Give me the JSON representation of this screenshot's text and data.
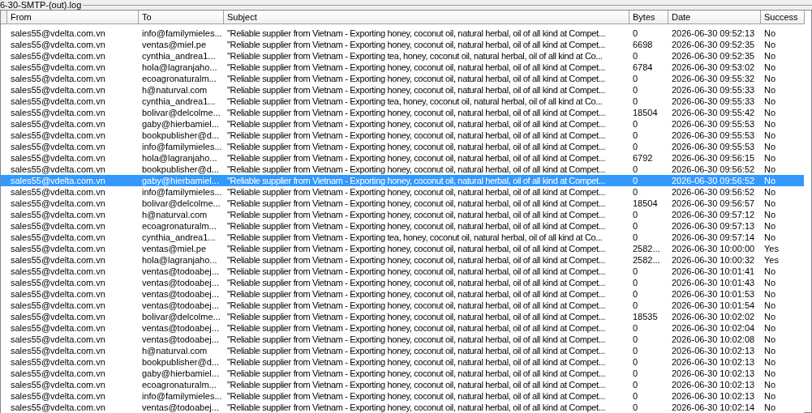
{
  "group_title": "6-30-SMTP-(out).log",
  "table": {
    "columns": [
      "From",
      "To",
      "Subject",
      "Bytes",
      "Date",
      "Success"
    ],
    "rows": [
      {
        "selected": false,
        "cells": [
          "sales55@vdelta.com.vn",
          "info@familymieles...",
          "\"Reliable supplier from Vietnam - Exporting honey, coconut oil, natural herbal, oil of all kind at Compet...",
          "0",
          "2026-06-30 09:52:13",
          "No"
        ]
      },
      {
        "selected": false,
        "cells": [
          "sales55@vdelta.com.vn",
          "ventas@miel.pe",
          "\"Reliable supplier from Vietnam - Exporting honey, coconut oil, natural herbal, oil of all kind at Compet...",
          "6698",
          "2026-06-30 09:52:35",
          "No"
        ]
      },
      {
        "selected": false,
        "cells": [
          "sales55@vdelta.com.vn",
          "cynthia_andrea1...",
          "\"Reliable supplier from Vietnam - Exporting tea, honey, coconut oil, natural herbal, oil of all kind at Co...",
          "0",
          "2026-06-30 09:52:35",
          "No"
        ]
      },
      {
        "selected": false,
        "cells": [
          "sales55@vdelta.com.vn",
          "hola@lagranjaho...",
          "\"Reliable supplier from Vietnam - Exporting honey, coconut oil, natural herbal, oil of all kind at Compet...",
          "6784",
          "2026-06-30 09:53:02",
          "No"
        ]
      },
      {
        "selected": false,
        "cells": [
          "sales55@vdelta.com.vn",
          "ecoagronaturalm...",
          "\"Reliable supplier from Vietnam - Exporting honey, coconut oil, natural herbal, oil of all kind at Compet...",
          "0",
          "2026-06-30 09:55:32",
          "No"
        ]
      },
      {
        "selected": false,
        "cells": [
          "sales55@vdelta.com.vn",
          "h@naturval.com",
          "\"Reliable supplier from Vietnam - Exporting honey, coconut oil, natural herbal, oil of all kind at Compet...",
          "0",
          "2026-06-30 09:55:33",
          "No"
        ]
      },
      {
        "selected": false,
        "cells": [
          "sales55@vdelta.com.vn",
          "cynthia_andrea1...",
          "\"Reliable supplier from Vietnam - Exporting tea, honey, coconut oil, natural herbal, oil of all kind at Co...",
          "0",
          "2026-06-30 09:55:33",
          "No"
        ]
      },
      {
        "selected": false,
        "cells": [
          "sales55@vdelta.com.vn",
          "bolivar@delcolme...",
          "\"Reliable supplier from Vietnam - Exporting honey, coconut oil, natural herbal, oil of all kind at Compet...",
          "18504",
          "2026-06-30 09:55:42",
          "No"
        ]
      },
      {
        "selected": false,
        "cells": [
          "sales55@vdelta.com.vn",
          "gaby@hierbamiel...",
          "\"Reliable supplier from Vietnam - Exporting honey, coconut oil, natural herbal, oil of all kind at Compet...",
          "0",
          "2026-06-30 09:55:53",
          "No"
        ]
      },
      {
        "selected": false,
        "cells": [
          "sales55@vdelta.com.vn",
          "bookpublisher@d...",
          "\"Reliable supplier from Vietnam - Exporting honey, coconut oil, natural herbal, oil of all kind at Compet...",
          "0",
          "2026-06-30 09:55:53",
          "No"
        ]
      },
      {
        "selected": false,
        "cells": [
          "sales55@vdelta.com.vn",
          "info@familymieles...",
          "\"Reliable supplier from Vietnam - Exporting honey, coconut oil, natural herbal, oil of all kind at Compet...",
          "0",
          "2026-06-30 09:55:53",
          "No"
        ]
      },
      {
        "selected": false,
        "cells": [
          "sales55@vdelta.com.vn",
          "hola@lagranjaho...",
          "\"Reliable supplier from Vietnam - Exporting honey, coconut oil, natural herbal, oil of all kind at Compet...",
          "6792",
          "2026-06-30 09:56:15",
          "No"
        ]
      },
      {
        "selected": false,
        "cells": [
          "sales55@vdelta.com.vn",
          "bookpublisher@d...",
          "\"Reliable supplier from Vietnam - Exporting honey, coconut oil, natural herbal, oil of all kind at Compet...",
          "0",
          "2026-06-30 09:56:52",
          "No"
        ]
      },
      {
        "selected": true,
        "cells": [
          "sales55@vdelta.com.vn",
          "gaby@hierbamiel...",
          "\"Reliable supplier from Vietnam - Exporting honey, coconut oil, natural herbal, oil of all kind at Compet...",
          "0",
          "2026-06-30 09:56:52",
          "No"
        ]
      },
      {
        "selected": false,
        "cells": [
          "sales55@vdelta.com.vn",
          "info@familymieles...",
          "\"Reliable supplier from Vietnam - Exporting honey, coconut oil, natural herbal, oil of all kind at Compet...",
          "0",
          "2026-06-30 09:56:52",
          "No"
        ]
      },
      {
        "selected": false,
        "cells": [
          "sales55@vdelta.com.vn",
          "bolivar@delcolme...",
          "\"Reliable supplier from Vietnam - Exporting honey, coconut oil, natural herbal, oil of all kind at Compet...",
          "18504",
          "2026-06-30 09:56:57",
          "No"
        ]
      },
      {
        "selected": false,
        "cells": [
          "sales55@vdelta.com.vn",
          "h@naturval.com",
          "\"Reliable supplier from Vietnam - Exporting honey, coconut oil, natural herbal, oil of all kind at Compet...",
          "0",
          "2026-06-30 09:57:12",
          "No"
        ]
      },
      {
        "selected": false,
        "cells": [
          "sales55@vdelta.com.vn",
          "ecoagronaturalm...",
          "\"Reliable supplier from Vietnam - Exporting honey, coconut oil, natural herbal, oil of all kind at Compet...",
          "0",
          "2026-06-30 09:57:13",
          "No"
        ]
      },
      {
        "selected": false,
        "cells": [
          "sales55@vdelta.com.vn",
          "cynthia_andrea1...",
          "\"Reliable supplier from Vietnam - Exporting tea, honey, coconut oil, natural herbal, oil of all kind at Co...",
          "0",
          "2026-06-30 09:57:14",
          "No"
        ]
      },
      {
        "selected": false,
        "cells": [
          "sales55@vdelta.com.vn",
          "ventas@miel.pe",
          "\"Reliable supplier from Vietnam - Exporting honey, coconut oil, natural herbal, oil of all kind at Compet...",
          "2582...",
          "2026-06-30 10:00:00",
          "Yes"
        ]
      },
      {
        "selected": false,
        "cells": [
          "sales55@vdelta.com.vn",
          "hola@lagranjaho...",
          "\"Reliable supplier from Vietnam - Exporting honey, coconut oil, natural herbal, oil of all kind at Compet...",
          "2582...",
          "2026-06-30 10:00:32",
          "Yes"
        ]
      },
      {
        "selected": false,
        "cells": [
          "sales55@vdelta.com.vn",
          "ventas@todoabej...",
          "\"Reliable supplier from Vietnam - Exporting honey, coconut oil, natural herbal, oil of all kind at Compet...",
          "0",
          "2026-06-30 10:01:41",
          "No"
        ]
      },
      {
        "selected": false,
        "cells": [
          "sales55@vdelta.com.vn",
          "ventas@todoabej...",
          "\"Reliable supplier from Vietnam - Exporting honey, coconut oil, natural herbal, oil of all kind at Compet...",
          "0",
          "2026-06-30 10:01:43",
          "No"
        ]
      },
      {
        "selected": false,
        "cells": [
          "sales55@vdelta.com.vn",
          "ventas@todoabej...",
          "\"Reliable supplier from Vietnam - Exporting honey, coconut oil, natural herbal, oil of all kind at Compet...",
          "0",
          "2026-06-30 10:01:53",
          "No"
        ]
      },
      {
        "selected": false,
        "cells": [
          "sales55@vdelta.com.vn",
          "ventas@todoabej...",
          "\"Reliable supplier from Vietnam - Exporting honey, coconut oil, natural herbal, oil of all kind at Compet...",
          "0",
          "2026-06-30 10:01:54",
          "No"
        ]
      },
      {
        "selected": false,
        "cells": [
          "sales55@vdelta.com.vn",
          "bolivar@delcolme...",
          "\"Reliable supplier from Vietnam - Exporting honey, coconut oil, natural herbal, oil of all kind at Compet...",
          "18535",
          "2026-06-30 10:02:02",
          "No"
        ]
      },
      {
        "selected": false,
        "cells": [
          "sales55@vdelta.com.vn",
          "ventas@todoabej...",
          "\"Reliable supplier from Vietnam - Exporting honey, coconut oil, natural herbal, oil of all kind at Compet...",
          "0",
          "2026-06-30 10:02:04",
          "No"
        ]
      },
      {
        "selected": false,
        "cells": [
          "sales55@vdelta.com.vn",
          "ventas@todoabej...",
          "\"Reliable supplier from Vietnam - Exporting honey, coconut oil, natural herbal, oil of all kind at Compet...",
          "0",
          "2026-06-30 10:02:08",
          "No"
        ]
      },
      {
        "selected": false,
        "cells": [
          "sales55@vdelta.com.vn",
          "h@naturval.com",
          "\"Reliable supplier from Vietnam - Exporting honey, coconut oil, natural herbal, oil of all kind at Compet...",
          "0",
          "2026-06-30 10:02:13",
          "No"
        ]
      },
      {
        "selected": false,
        "cells": [
          "sales55@vdelta.com.vn",
          "bookpublisher@d...",
          "\"Reliable supplier from Vietnam - Exporting honey, coconut oil, natural herbal, oil of all kind at Compet...",
          "0",
          "2026-06-30 10:02:13",
          "No"
        ]
      },
      {
        "selected": false,
        "cells": [
          "sales55@vdelta.com.vn",
          "gaby@hierbamiel...",
          "\"Reliable supplier from Vietnam - Exporting honey, coconut oil, natural herbal, oil of all kind at Compet...",
          "0",
          "2026-06-30 10:02:13",
          "No"
        ]
      },
      {
        "selected": false,
        "cells": [
          "sales55@vdelta.com.vn",
          "ecoagronaturalm...",
          "\"Reliable supplier from Vietnam - Exporting honey, coconut oil, natural herbal, oil of all kind at Compet...",
          "0",
          "2026-06-30 10:02:13",
          "No"
        ]
      },
      {
        "selected": false,
        "cells": [
          "sales55@vdelta.com.vn",
          "info@familymieles...",
          "\"Reliable supplier from Vietnam - Exporting honey, coconut oil, natural herbal, oil of all kind at Compet...",
          "0",
          "2026-06-30 10:02:13",
          "No"
        ]
      },
      {
        "selected": false,
        "cells": [
          "sales55@vdelta.com.vn",
          "ventas@todoabej...",
          "\"Reliable supplier from Vietnam - Exporting honey, coconut oil, natural herbal, oil of all kind at Compet...",
          "0",
          "2026-06-30 10:02:14",
          "No"
        ]
      }
    ]
  }
}
